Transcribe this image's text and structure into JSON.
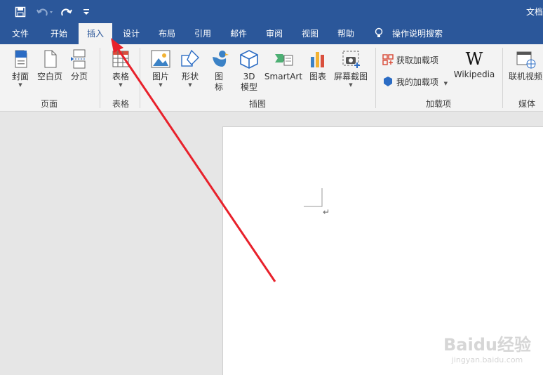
{
  "window": {
    "title": "文档"
  },
  "quick_access": {
    "save_icon": "save-icon",
    "undo_icon": "undo-icon",
    "redo_icon": "redo-icon",
    "customize_icon": "customize-icon"
  },
  "tabs": [
    "文件",
    "开始",
    "插入",
    "设计",
    "布局",
    "引用",
    "邮件",
    "审阅",
    "视图",
    "帮助"
  ],
  "active_tab": "插入",
  "tell_me": {
    "label": "操作说明搜索"
  },
  "ribbon": {
    "pages": {
      "group_label": "页面",
      "cover": "封面",
      "blank": "空白页",
      "break": "分页"
    },
    "tables": {
      "group_label": "表格",
      "table": "表格"
    },
    "illustrations": {
      "group_label": "插图",
      "picture": "图片",
      "shape": "形状",
      "icons": "图\n标",
      "model3d": "3D\n模型",
      "smartart": "SmartArt",
      "chart": "图表",
      "screenshot": "屏幕截图"
    },
    "addins": {
      "group_label": "加载项",
      "get": "获取加载项",
      "mine": "我的加载项",
      "wikipedia": "Wikipedia"
    },
    "media": {
      "group_label": "媒体",
      "online_video": "联机视频"
    }
  },
  "document": {
    "paragraph_mark": "↵"
  },
  "watermark": {
    "line1": "Baidu经验",
    "line2": "jingyan.baidu.com"
  },
  "colors": {
    "brand": "#2b579a",
    "annotation": "#e8212b"
  }
}
